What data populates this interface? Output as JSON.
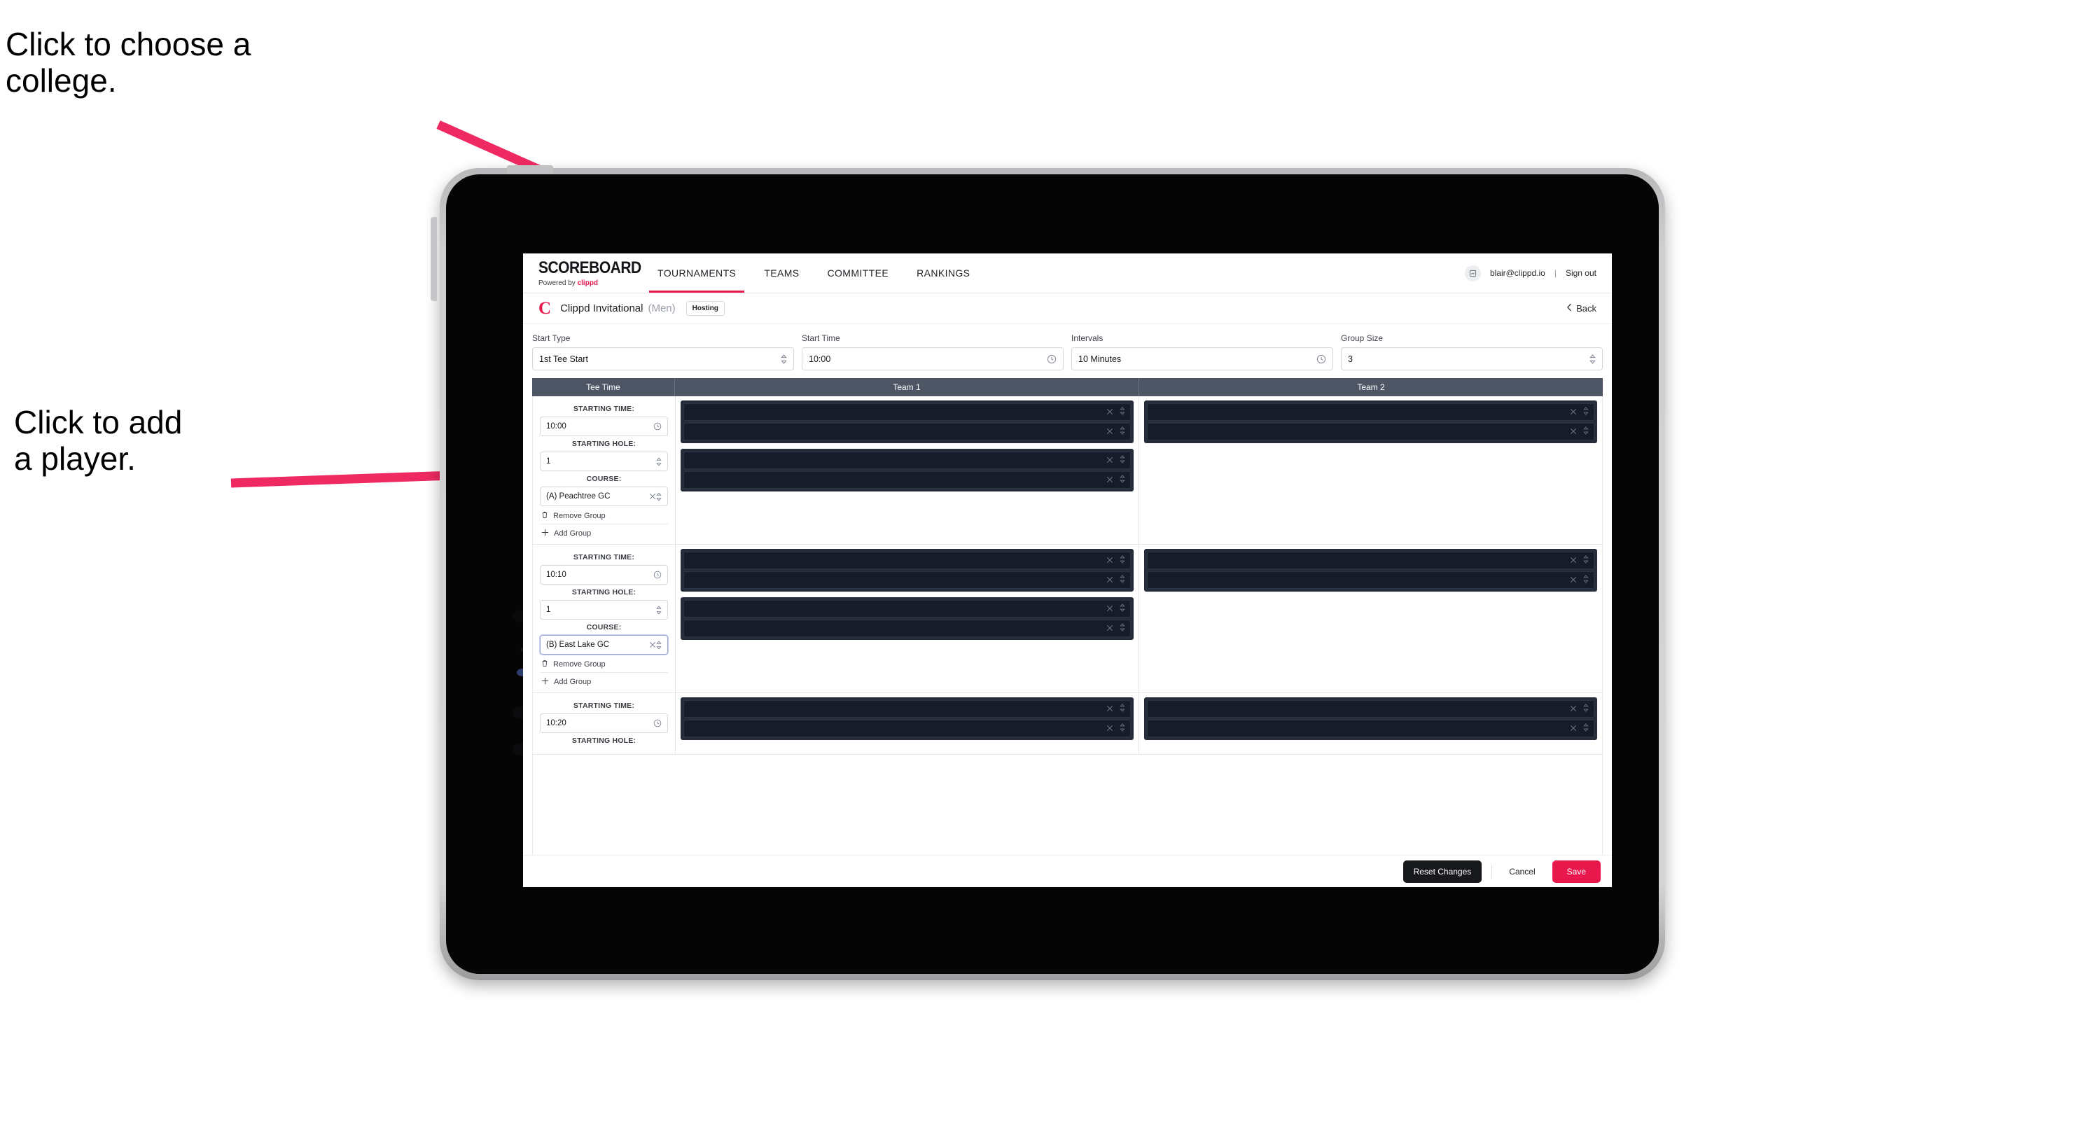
{
  "annotations": {
    "college": "Click to choose a\ncollege.",
    "player": "Click to add\na player."
  },
  "colors": {
    "accent": "#e8174c",
    "table_header": "#4e5565",
    "player_group": "#262d3a",
    "player_row": "#161c29",
    "dark_button": "#17181c"
  },
  "app": {
    "logo": {
      "title": "SCOREBOARD",
      "powered_prefix": "Powered by",
      "powered_brand": "clippd"
    },
    "nav": [
      {
        "label": "TOURNAMENTS",
        "active": true
      },
      {
        "label": "TEAMS",
        "active": false
      },
      {
        "label": "COMMITTEE",
        "active": false
      },
      {
        "label": "RANKINGS",
        "active": false
      }
    ],
    "account": {
      "avatar_icon": "user-avatar-icon",
      "email": "blair@clippd.io",
      "separator": "|",
      "sign_out": "Sign out"
    },
    "subheader": {
      "brand_mark": "C",
      "tournament_name": "Clippd Invitational",
      "gender": "(Men)",
      "badge": "Hosting",
      "back_label": "Back",
      "back_icon": "chevron-left-icon"
    },
    "controls": [
      {
        "label": "Start Type",
        "value": "1st Tee Start",
        "icon": "stepper-icon"
      },
      {
        "label": "Start Time",
        "value": "10:00",
        "icon": "clock-icon"
      },
      {
        "label": "Intervals",
        "value": "10 Minutes",
        "icon": "clock-icon"
      },
      {
        "label": "Group Size",
        "value": "3",
        "icon": "stepper-icon"
      }
    ],
    "table": {
      "headers": {
        "tee_time": "Tee Time",
        "team1": "Team 1",
        "team2": "Team 2"
      },
      "labels": {
        "starting_time": "STARTING TIME:",
        "starting_hole": "STARTING HOLE:",
        "course": "COURSE:",
        "remove_group": "Remove Group",
        "add_group": "Add Group"
      },
      "groups": [
        {
          "starting_time": "10:00",
          "starting_hole": "1",
          "course": "(A) Peachtree GC",
          "course_focused": false,
          "team1": [
            {
              "players": [
                "",
                ""
              ]
            },
            {
              "players": [
                "",
                ""
              ]
            }
          ],
          "team2": [
            {
              "players": [
                "",
                ""
              ]
            }
          ]
        },
        {
          "starting_time": "10:10",
          "starting_hole": "1",
          "course": "(B) East Lake GC",
          "course_focused": true,
          "team1": [
            {
              "players": [
                "",
                ""
              ]
            },
            {
              "players": [
                "",
                ""
              ]
            }
          ],
          "team2": [
            {
              "players": [
                "",
                ""
              ]
            }
          ]
        },
        {
          "starting_time": "10:20",
          "starting_hole": "",
          "course": "",
          "course_focused": false,
          "team1": [
            {
              "players": [
                "",
                ""
              ]
            }
          ],
          "team2": [
            {
              "players": [
                "",
                ""
              ]
            }
          ]
        }
      ]
    },
    "footer": {
      "reset": "Reset Changes",
      "cancel": "Cancel",
      "save": "Save"
    }
  }
}
